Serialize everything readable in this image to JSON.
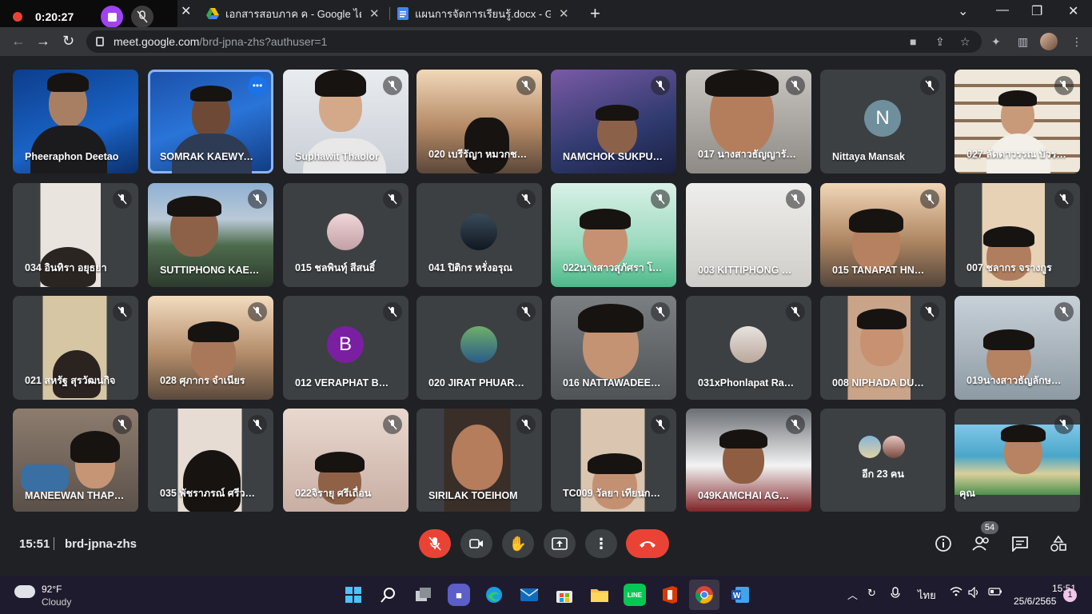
{
  "recording": {
    "time": "0:20:27"
  },
  "browser": {
    "tabs": [
      {
        "label": "เอกสารสอบภาค ค - Google ไดรฟ์"
      },
      {
        "label": "แผนการจัดการเรียนรู้.docx - Google"
      }
    ],
    "url_host": "meet.google.com",
    "url_path": "/brd-jpna-zhs?authuser=1"
  },
  "participants": [
    {
      "name": "Pheeraphon Deetao"
    },
    {
      "name": "SOMRAK KAEWYA…"
    },
    {
      "name": "Suphawit Thaolor"
    },
    {
      "name": "020 เบรีรัญา หมวกช…"
    },
    {
      "name": "NAMCHOK SUKPU…"
    },
    {
      "name": "017 นางสาวธัญญารั…"
    },
    {
      "name": "Nittaya Mansak",
      "initial": "N"
    },
    {
      "name": "027 ลัดดาวรรณ บัวร…"
    },
    {
      "name": "034 อินทิรา อยุธยา"
    },
    {
      "name": "SUTTIPHONG KAE…"
    },
    {
      "name": "015 ชลพินทุ์ สีสนธิ์"
    },
    {
      "name": "041 ปิติกร หรั่งอรุณ"
    },
    {
      "name": "022นางสาวสุภัศรา โ…"
    },
    {
      "name": "003 KITTIPHONG …"
    },
    {
      "name": "015 TANAPAT HN…"
    },
    {
      "name": "007 ชลากร จรางกูร"
    },
    {
      "name": "021 สหรัฐ สุรวัฒนกิจ"
    },
    {
      "name": "028 ศุภากร จำเนียร"
    },
    {
      "name": "012 VERAPHAT BO…",
      "initial": "B"
    },
    {
      "name": "020 JIRAT PHUAR…"
    },
    {
      "name": "016 NATTAWADEE …"
    },
    {
      "name": "031xPhonlapat Ra…"
    },
    {
      "name": "008 NIPHADA DU…"
    },
    {
      "name": "019นางสาวธัญลักษ…"
    },
    {
      "name": "MANEEWAN THAP…"
    },
    {
      "name": "035 พัชราภรณ์ ศรีวร…"
    },
    {
      "name": "022จิรายุ ศรีเถื่อน"
    },
    {
      "name": "SIRILAK TOEIHOM"
    },
    {
      "name": "TC009 วัลยา เทียนกสี…"
    },
    {
      "name": "049KAMCHAI AG…"
    },
    {
      "name": "อีก 23 คน"
    },
    {
      "name": "คุณ"
    }
  ],
  "meeting": {
    "time": "15:51",
    "code": "brd-jpna-zhs",
    "participant_count": "54"
  },
  "taskbar": {
    "weather_temp": "92°F",
    "weather_cond": "Cloudy",
    "language": "ไทย",
    "clock": "15:51",
    "date": "25/6/2565",
    "notifications": "1"
  }
}
